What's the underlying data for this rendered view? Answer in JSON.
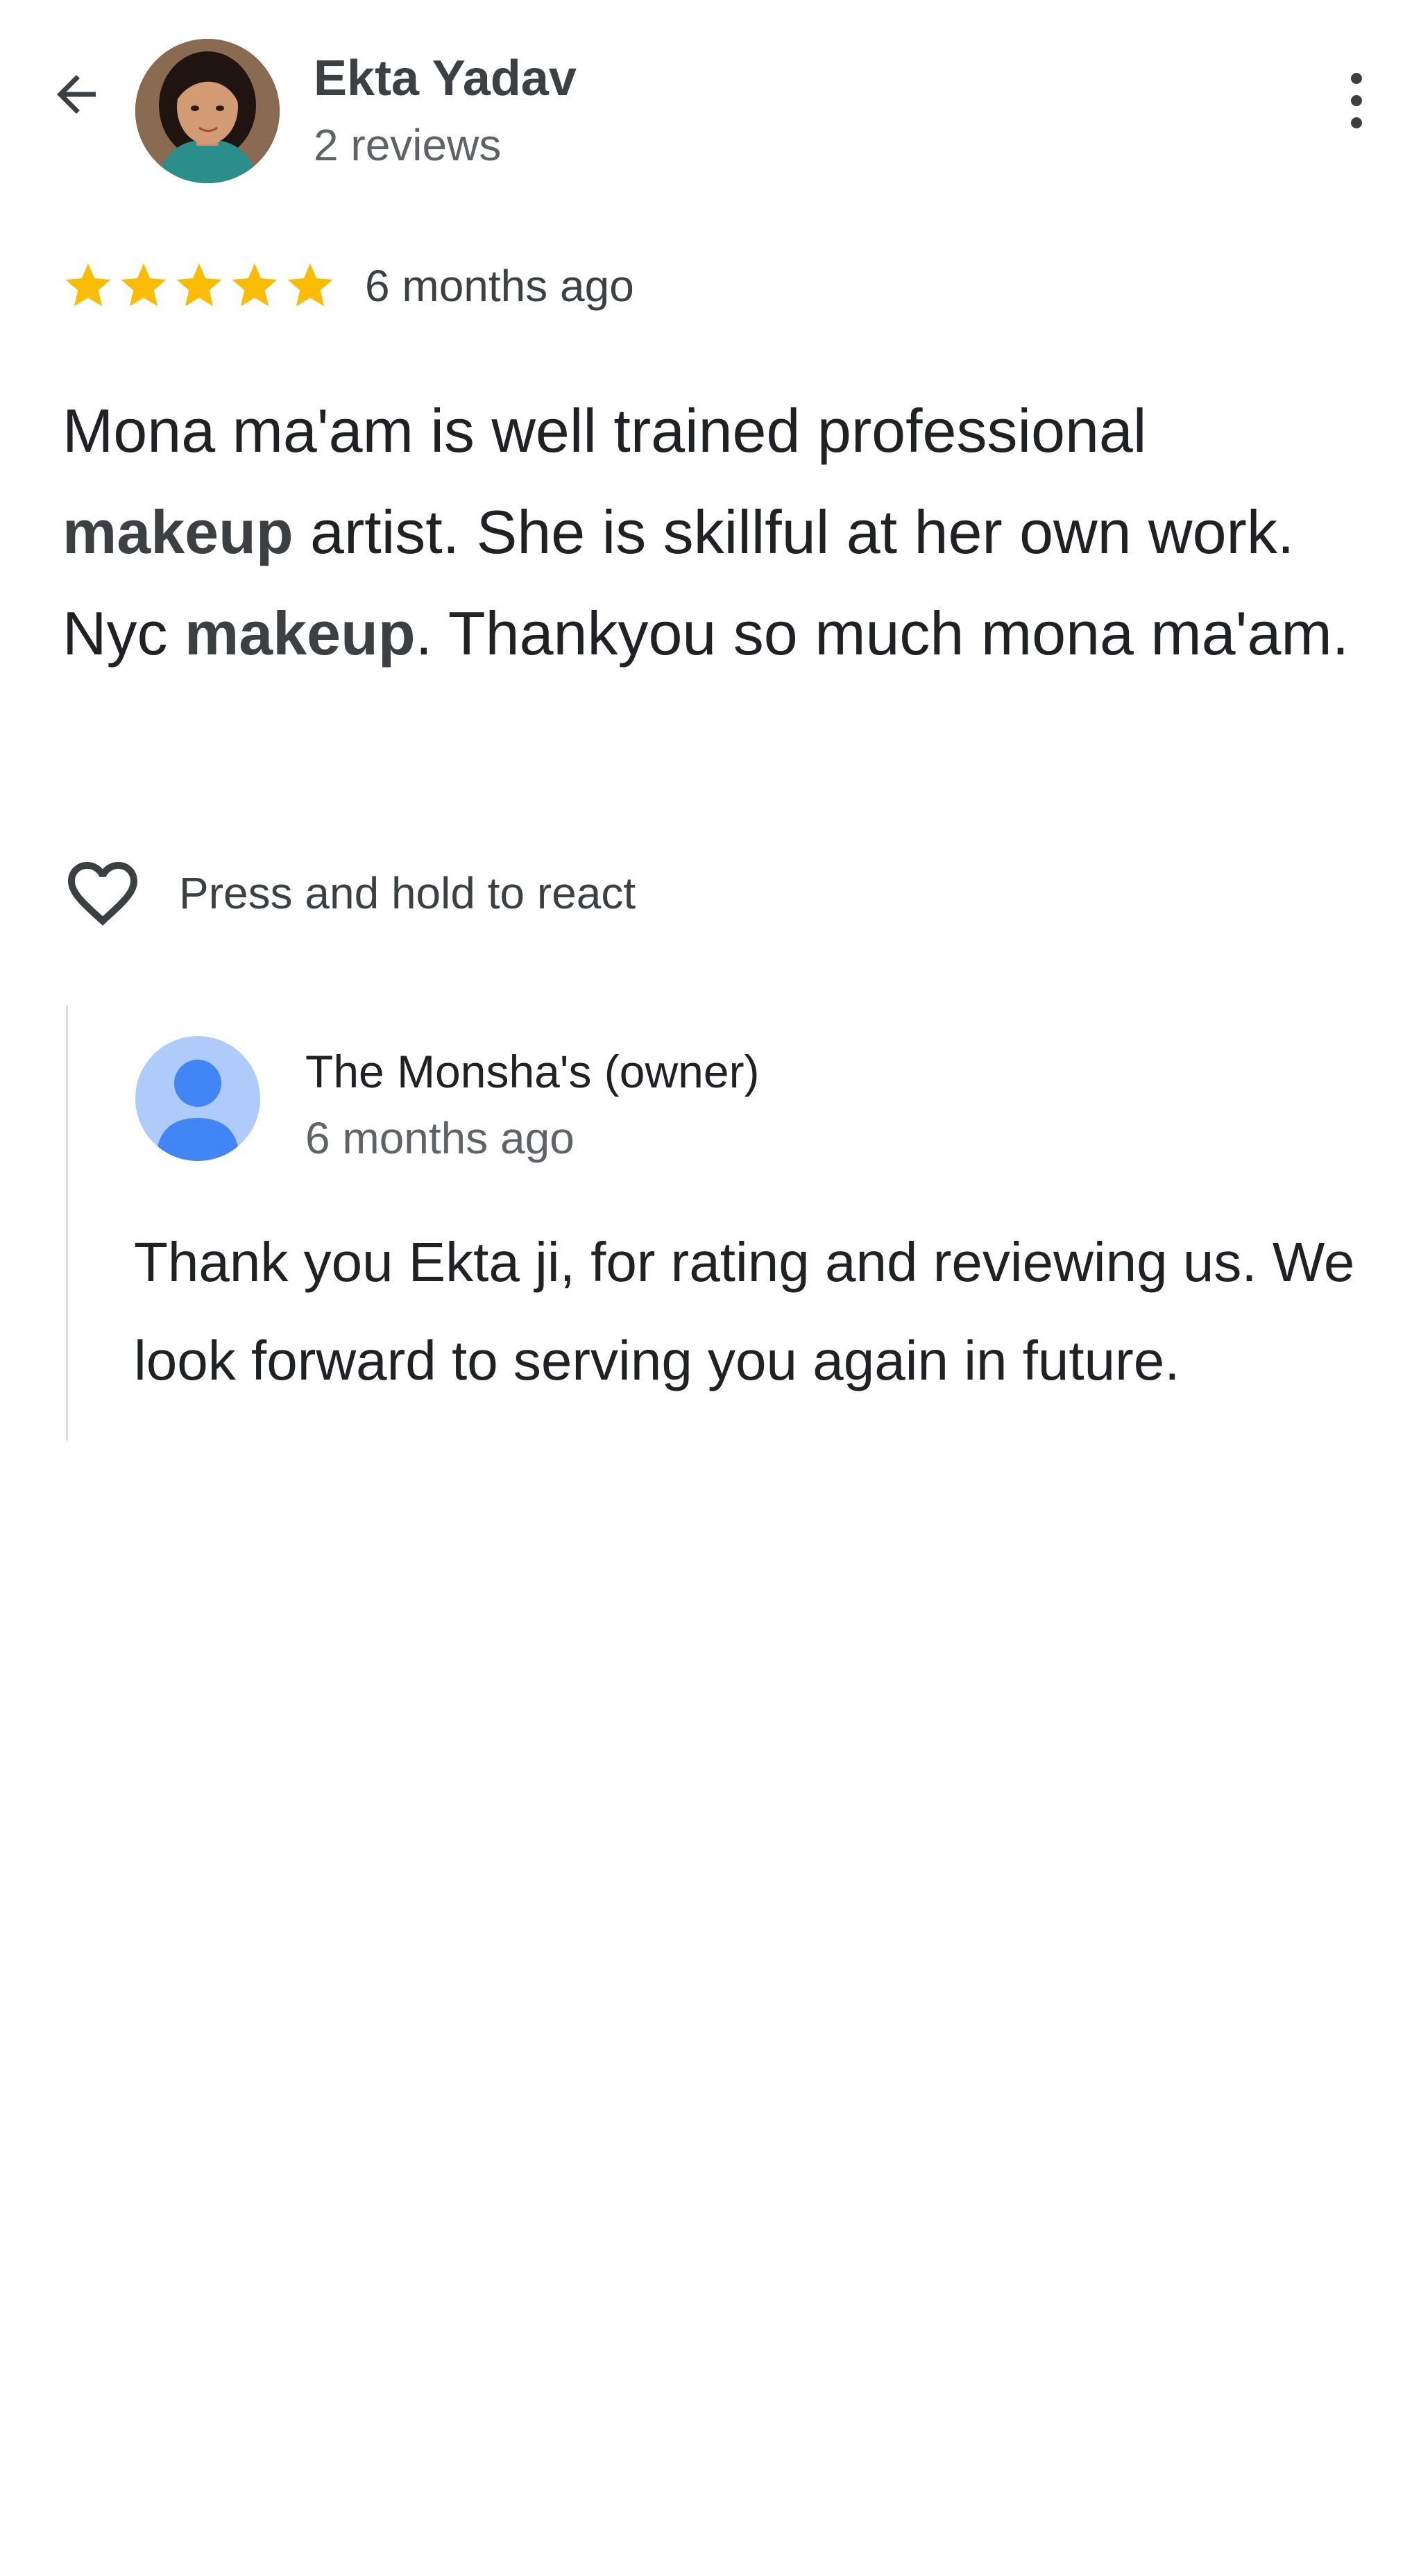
{
  "header": {
    "back_icon": "arrow-back-icon",
    "reviewer_name": "Ekta Yadav",
    "review_count": "2 reviews",
    "more_icon": "more-vert-icon"
  },
  "review": {
    "stars": 5,
    "star_color": "#FBBC04",
    "time": "6 months ago",
    "text": {
      "p1": "Mona ma'am is well trained professional ",
      "b1": "makeup",
      "p2": " artist. She is skillful at her own work. Nyc ",
      "b2": "makeup",
      "p3": ". Thankyou so much mona ma'am."
    }
  },
  "reaction": {
    "icon": "heart-outline-icon",
    "label": "Press and hold to react"
  },
  "owner_reply": {
    "avatar_icon": "person-icon",
    "avatar_color": "#aecbfa",
    "name": "The Monsha's (owner)",
    "time": "6 months ago",
    "text": "Thank you Ekta ji, for rating and reviewing us. We look forward to serving you again in future."
  }
}
